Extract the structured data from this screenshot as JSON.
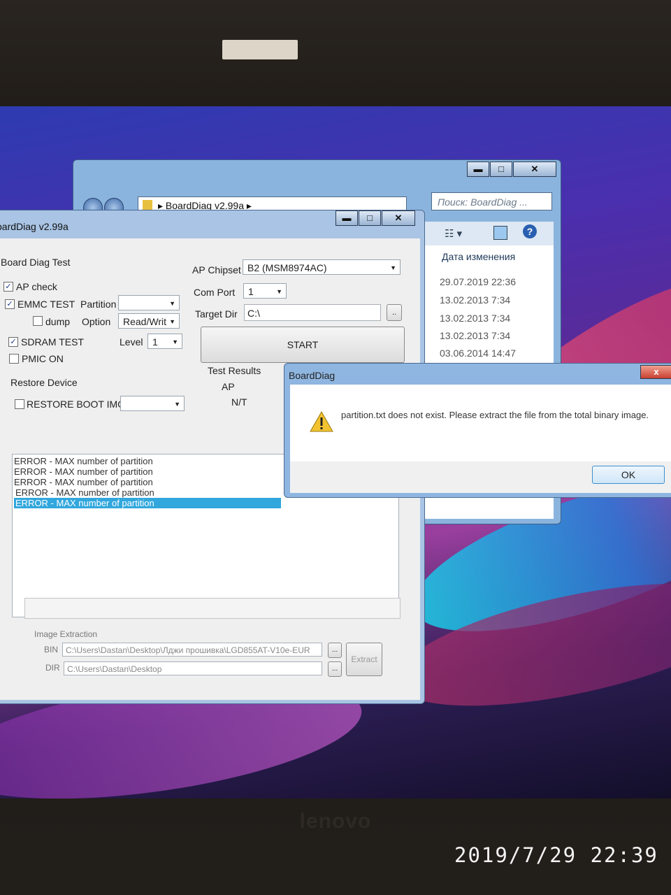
{
  "explorer": {
    "breadcrumb": "BoardDiag v2.99a",
    "search_placeholder": "Поиск: BoardDiag ...",
    "column_date": "Дата изменения",
    "rows": [
      "29.07.2019 22:36",
      "13.02.2013 7:34",
      "13.02.2013 7:34",
      "13.02.2013 7:34",
      "03.06.2014 14:47"
    ]
  },
  "boarddiag": {
    "title": "oardDiag v2.99a",
    "group_title": "Board Diag Test",
    "ap_check": "AP check",
    "emmc_test": "EMMC TEST",
    "partition_label": "Partition",
    "dump": "dump",
    "option_label": "Option",
    "option_value": "Read/Writ",
    "sdram_test": "SDRAM TEST",
    "level_label": "Level",
    "level_value": "1",
    "pmic_on": "PMIC ON",
    "restore_device": "Restore Device",
    "restore_boot_img": "RESTORE BOOT IMG",
    "ap_chipset_label": "AP Chipset",
    "ap_chipset_value": "B2 (MSM8974AC)",
    "com_port_label": "Com Port",
    "com_port_value": "1",
    "target_dir_label": "Target Dir",
    "target_dir_value": "C:\\",
    "browse": "..",
    "start": "START",
    "test_results": "Test Results",
    "ap": "AP",
    "nt": "N/T",
    "log": [
      "ERROR - MAX number of partition",
      "ERROR - MAX number of partition",
      "ERROR - MAX number of partition",
      "ERROR - MAX number of partition",
      "ERROR - MAX number of partition"
    ],
    "image_extraction": "Image Extraction",
    "bin_label": "BIN",
    "bin_value": "C:\\Users\\Dastan\\Desktop\\Лджи прошивка\\LGD855AT-V10e-EUR",
    "dir_label": "DIR",
    "dir_value": "C:\\Users\\Dastan\\Desktop",
    "dots": "...",
    "extract": "Extract"
  },
  "dialog": {
    "title": "BoardDiag",
    "message": "partition.txt does not exist. Please extract the file from the total binary image.",
    "ok": "OK",
    "close": "x"
  },
  "laptop": {
    "brand": "lenovo",
    "timestamp": "2019/7/29  22:39"
  },
  "colors": {
    "accent": "#31a7dd",
    "desktop": "#4a2fae"
  }
}
